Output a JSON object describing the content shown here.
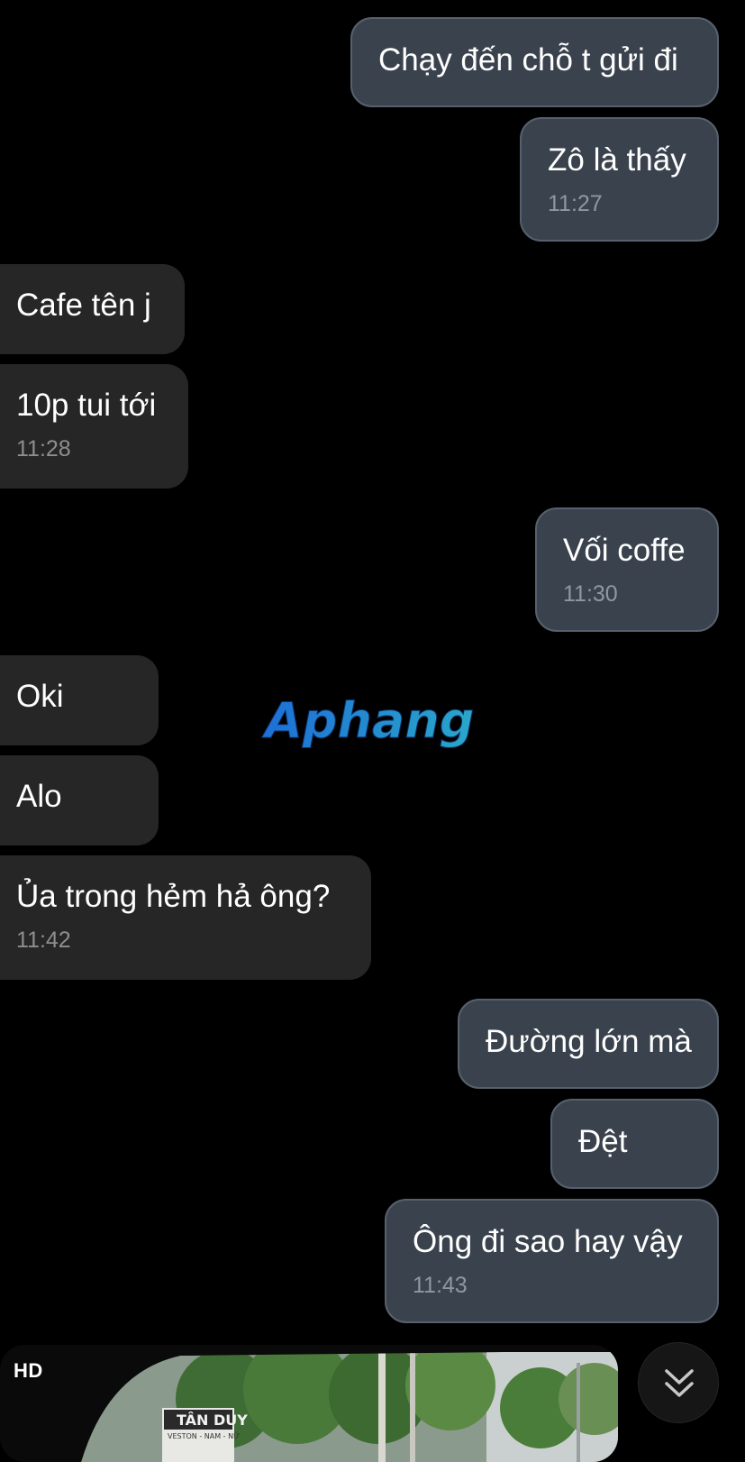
{
  "messages": [
    {
      "direction": "outgoing",
      "text": "Chạy đến chỗ t gửi đi"
    },
    {
      "direction": "outgoing",
      "text": "Zô là thấy",
      "time": "11:27"
    },
    {
      "direction": "incoming",
      "text": "Cafe tên j"
    },
    {
      "direction": "incoming",
      "text": "10p tui tới",
      "time": "11:28"
    },
    {
      "direction": "outgoing",
      "text": "Vối coffe",
      "time": "11:30"
    },
    {
      "direction": "incoming",
      "text": "Oki"
    },
    {
      "direction": "incoming",
      "text": "Alo"
    },
    {
      "direction": "incoming",
      "text": "Ủa trong hẻm hả ông?",
      "time": "11:42"
    },
    {
      "direction": "outgoing",
      "text": "Đường lớn mà"
    },
    {
      "direction": "outgoing",
      "text": "Đệt"
    },
    {
      "direction": "outgoing",
      "text": "Ông đi sao hay vậy",
      "time": "11:43"
    }
  ],
  "watermark": {
    "text": "Aphang",
    "colors": [
      "#c8141e",
      "#1d6fd6",
      "#2aa7c9"
    ]
  },
  "video_preview": {
    "badge": "HD",
    "sign_text": "TÂN DUY",
    "sign_subtext": "VESTON - NAM - NỮ"
  },
  "scroll_button": {
    "icon": "double-chevron-down-icon"
  },
  "colors": {
    "background": "#000000",
    "outgoing_bubble": "#3a434d",
    "incoming_bubble": "#262626",
    "timestamp": "#8f979f"
  }
}
